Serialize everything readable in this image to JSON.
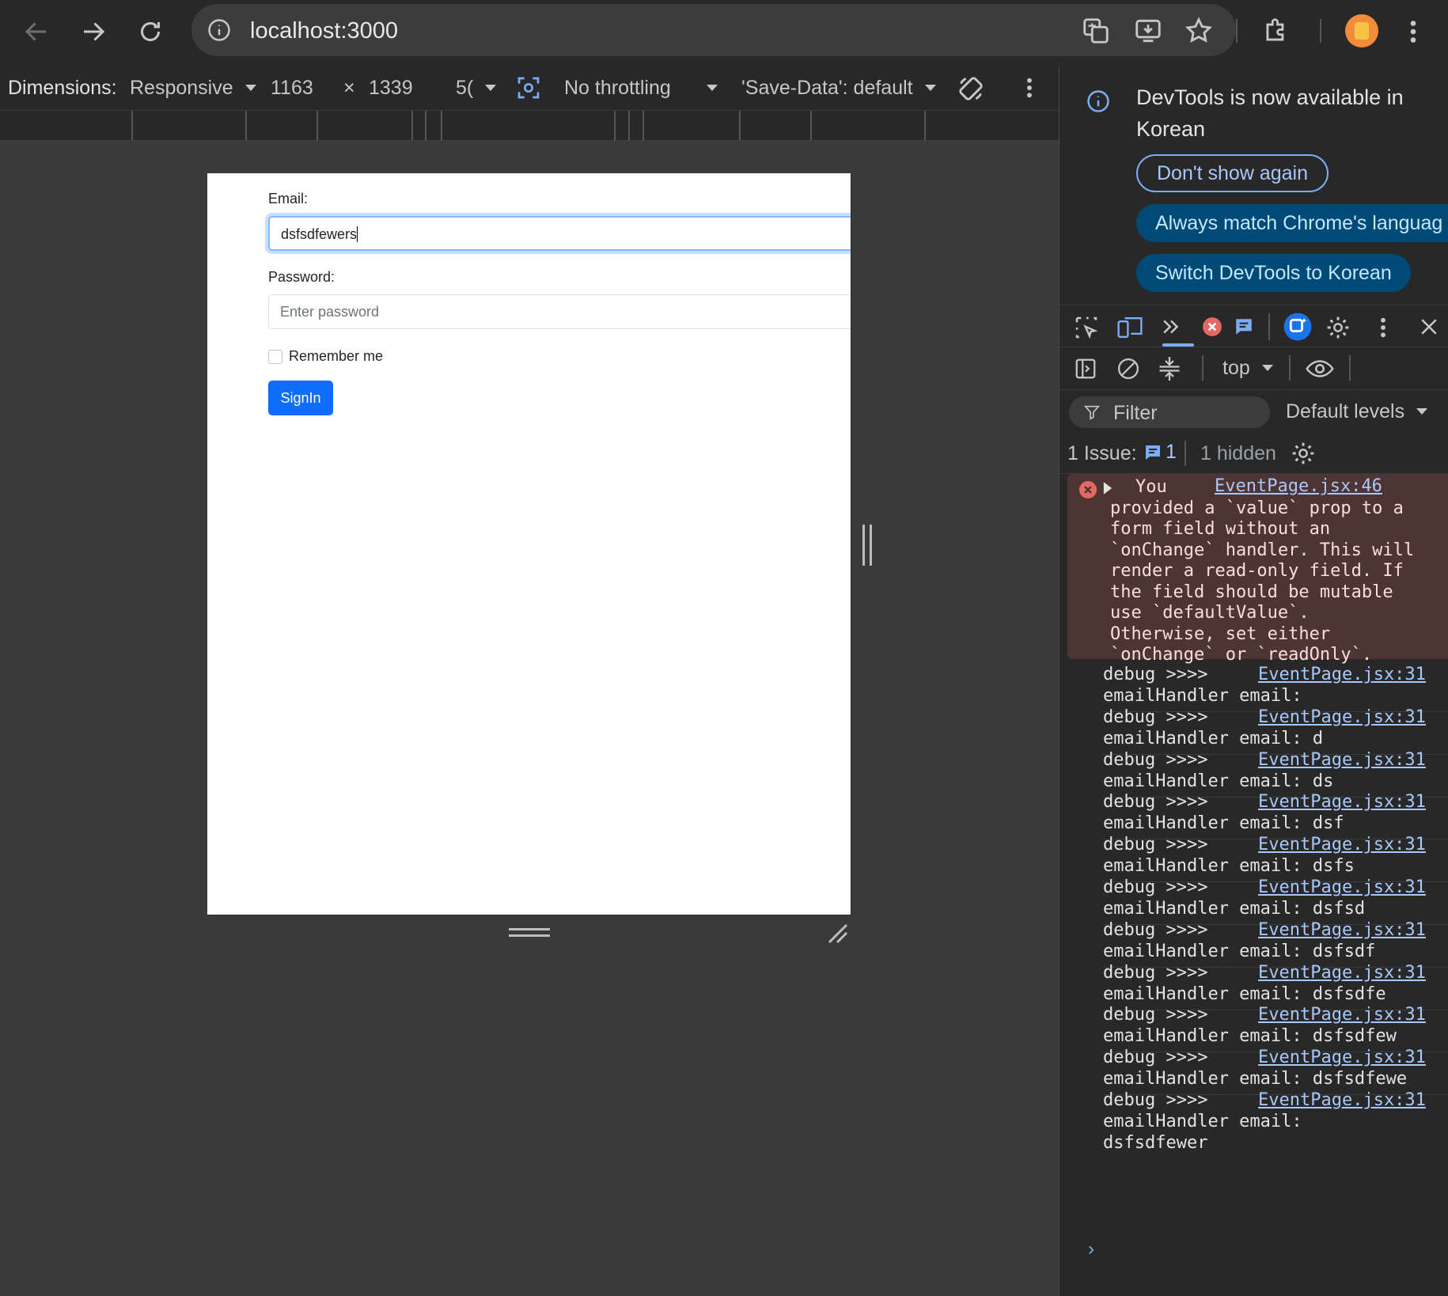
{
  "browser": {
    "url": "localhost:3000"
  },
  "device_toolbar": {
    "dimensions_label": "Dimensions:",
    "device": "Responsive",
    "width": "1163",
    "times": "×",
    "height": "1339",
    "zoom": "5(",
    "throttling": "No throttling",
    "save_data": "'Save-Data': default"
  },
  "page": {
    "email_label": "Email:",
    "email_value": "dsfsdfewers",
    "password_label": "Password:",
    "password_placeholder": "Enter password",
    "remember_label": "Remember me",
    "signin_label": "SignIn"
  },
  "devtools": {
    "notice": "DevTools is now available in Korean",
    "dont_show": "Don't show again",
    "always_match": "Always match Chrome's languag",
    "switch_korean": "Switch DevTools to Korean",
    "context": "top",
    "filter_placeholder": "Filter",
    "levels": "Default levels",
    "issues_label": "1 Issue:",
    "issues_count": "1",
    "hidden": "1 hidden",
    "error": {
      "source": "EventPage.jsx:46",
      "lines": [
        "You",
        "provided a `value` prop to a",
        "form field without an",
        "`onChange` handler. This will",
        "render a read-only field. If",
        "the field should be mutable",
        "use `defaultValue`.",
        "Otherwise, set either",
        "`onChange` or `readOnly`."
      ]
    },
    "logs": [
      {
        "prefix": "debug >>>>",
        "source": "EventPage.jsx:31",
        "text": "emailHandler email:"
      },
      {
        "prefix": "debug >>>>",
        "source": "EventPage.jsx:31",
        "text": "emailHandler email: d"
      },
      {
        "prefix": "debug >>>>",
        "source": "EventPage.jsx:31",
        "text": "emailHandler email: ds"
      },
      {
        "prefix": "debug >>>>",
        "source": "EventPage.jsx:31",
        "text": "emailHandler email: dsf"
      },
      {
        "prefix": "debug >>>>",
        "source": "EventPage.jsx:31",
        "text": "emailHandler email: dsfs"
      },
      {
        "prefix": "debug >>>>",
        "source": "EventPage.jsx:31",
        "text": "emailHandler email: dsfsd"
      },
      {
        "prefix": "debug >>>>",
        "source": "EventPage.jsx:31",
        "text": "emailHandler email: dsfsdf"
      },
      {
        "prefix": "debug >>>>",
        "source": "EventPage.jsx:31",
        "text": "emailHandler email: dsfsdfe"
      },
      {
        "prefix": "debug >>>>",
        "source": "EventPage.jsx:31",
        "text": "emailHandler email: dsfsdfew"
      },
      {
        "prefix": "debug >>>>",
        "source": "EventPage.jsx:31",
        "text": "emailHandler email: dsfsdfewe"
      },
      {
        "prefix": "debug >>>>",
        "source": "EventPage.jsx:31",
        "text": "emailHandler email:",
        "text2": "dsfsdfewer"
      }
    ],
    "prompt": "›"
  }
}
